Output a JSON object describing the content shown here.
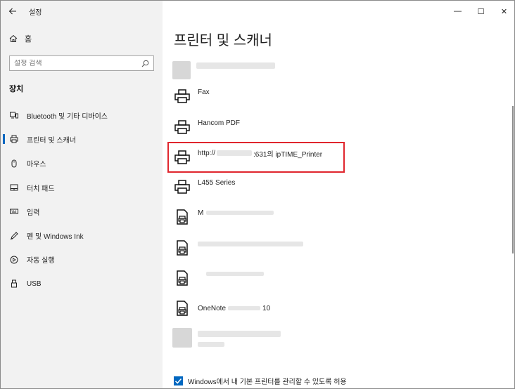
{
  "app": {
    "title": "설정"
  },
  "window_controls": {
    "minimize": "—",
    "maximize": "☐",
    "close": "✕"
  },
  "sidebar": {
    "home_label": "홈",
    "search_placeholder": "설정 검색",
    "section_title": "장치",
    "items": [
      {
        "label": "Bluetooth 및 기타 디바이스",
        "icon": "bluetooth-devices-icon",
        "active": false
      },
      {
        "label": "프린터 및 스캐너",
        "icon": "printer-icon",
        "active": true
      },
      {
        "label": "마우스",
        "icon": "mouse-icon",
        "active": false
      },
      {
        "label": "터치 패드",
        "icon": "touchpad-icon",
        "active": false
      },
      {
        "label": "입력",
        "icon": "keyboard-icon",
        "active": false
      },
      {
        "label": "펜 및 Windows Ink",
        "icon": "pen-icon",
        "active": false
      },
      {
        "label": "자동 실행",
        "icon": "autoplay-icon",
        "active": false
      },
      {
        "label": "USB",
        "icon": "usb-icon",
        "active": false
      }
    ]
  },
  "main": {
    "title": "프린터 및 스캐너",
    "printers": [
      {
        "name": "Fax",
        "icon": "printer-icon"
      },
      {
        "name": "Hancom PDF",
        "icon": "printer-icon"
      },
      {
        "name_prefix": "http://",
        "name_suffix": ":631의 ipTIME_Printer",
        "icon": "printer-icon",
        "highlighted": true
      },
      {
        "name": "L455 Series",
        "icon": "printer-icon"
      },
      {
        "name": "M",
        "icon": "document-printer-icon"
      },
      {
        "name": "",
        "icon": "document-printer-icon"
      },
      {
        "name": "",
        "icon": "document-printer-icon"
      },
      {
        "name_prefix": "OneNote",
        "name_suffix": "10",
        "icon": "document-printer-icon"
      }
    ],
    "default_printer_checkbox": {
      "label": "Windows에서 내 기본 프린터를 관리할 수 있도록 허용",
      "checked": true
    }
  }
}
